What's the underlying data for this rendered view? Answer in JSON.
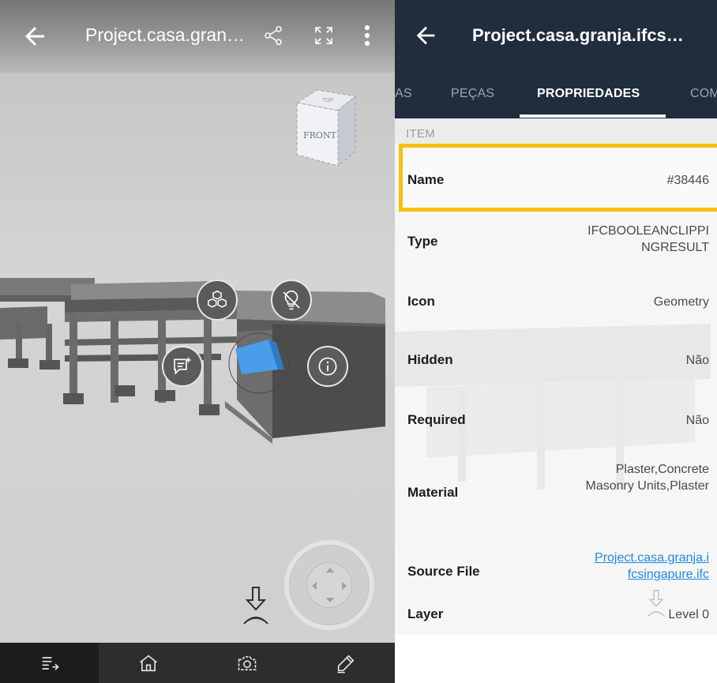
{
  "viewer": {
    "title": "Project.casa.gran…",
    "cube_top_label": "TOP",
    "cube_front_label": "FRONT",
    "icons": {
      "back": "arrow-left-icon",
      "share": "share-icon",
      "fullscreen": "fullscreen-icon",
      "more": "more-vertical-icon",
      "parts": "cubes-icon",
      "hide": "lightbulb-off-icon",
      "comment": "comment-add-icon",
      "info": "info-icon",
      "walk": "walk-icon"
    },
    "toolbar": [
      {
        "name": "list-icon",
        "active": true
      },
      {
        "name": "home-icon",
        "active": false
      },
      {
        "name": "camera-icon",
        "active": false
      },
      {
        "name": "pencil-icon",
        "active": false
      }
    ],
    "highlight_color": "#4a9de8"
  },
  "properties": {
    "title": "Project.casa.granja.ifcs…",
    "tabs": [
      "AS",
      "PEÇAS",
      "PROPRIEDADES",
      "COM"
    ],
    "active_tab": "PROPRIEDADES",
    "section": "ITEM",
    "rows": [
      {
        "label": "Name",
        "value": "#38446"
      },
      {
        "label": "Type",
        "value": "IFCBOOLEANCLIPPI NGRESULT"
      },
      {
        "label": "Icon",
        "value": "Geometry"
      },
      {
        "label": "Hidden",
        "value": "Não"
      },
      {
        "label": "Required",
        "value": "Não"
      },
      {
        "label": "Material",
        "value": "Plaster,Concrete Masonry Units,Plaster"
      },
      {
        "label": "Source File",
        "value": "Project.casa.granja.i fcsingapure.ifc"
      },
      {
        "label": "Layer",
        "value": "Level 0"
      }
    ],
    "colors": {
      "header": "#1f2d3d",
      "highlight_border": "#f5c012",
      "link": "#1e88e5"
    }
  }
}
